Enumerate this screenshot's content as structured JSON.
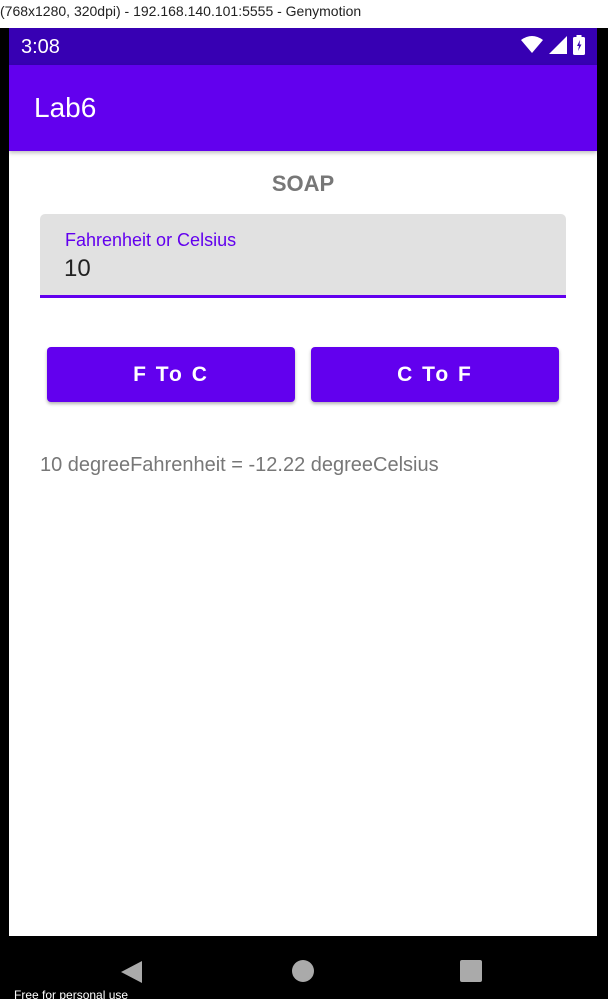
{
  "window": {
    "title": "(768x1280, 320dpi) - 192.168.140.101:5555 - Genymotion"
  },
  "status_bar": {
    "time": "3:08",
    "icons": [
      "wifi-icon",
      "signal-icon",
      "battery-icon"
    ]
  },
  "app_bar": {
    "title": "Lab6"
  },
  "main": {
    "header": "SOAP",
    "input": {
      "label": "Fahrenheit or Celsius",
      "value": "10"
    },
    "buttons": {
      "f_to_c": "F To C",
      "c_to_f": "C To F"
    },
    "result": "10 degreeFahrenheit = -12.22 degreeCelsius"
  },
  "nav_bar": {
    "icons": [
      "back-icon",
      "home-icon",
      "recents-icon"
    ]
  },
  "watermark": "Free for personal use",
  "colors": {
    "primary": "#6200EE",
    "primary_dark": "#3700B3",
    "field_background": "#E1E1E1",
    "text_secondary": "#777777"
  }
}
